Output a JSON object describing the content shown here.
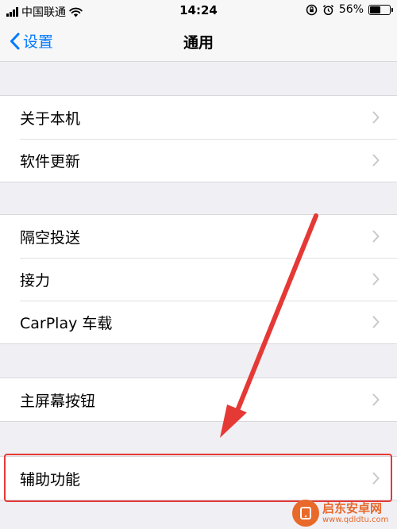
{
  "status_bar": {
    "carrier": "中国联通",
    "time": "14:24",
    "battery_percent": "56%",
    "battery_level": 0.56
  },
  "nav": {
    "back_label": "设置",
    "title": "通用"
  },
  "groups": [
    {
      "items": [
        {
          "label": "关于本机"
        },
        {
          "label": "软件更新"
        }
      ]
    },
    {
      "items": [
        {
          "label": "隔空投送"
        },
        {
          "label": "接力"
        },
        {
          "label": "CarPlay 车载"
        }
      ]
    },
    {
      "items": [
        {
          "label": "主屏幕按钮"
        }
      ]
    },
    {
      "items": [
        {
          "label": "辅助功能"
        }
      ]
    }
  ],
  "annotation": {
    "color": "#e53935"
  },
  "watermark": {
    "title": "启东安卓网",
    "url": "www.qdldtu.com"
  },
  "colors": {
    "accent": "#007aff",
    "background": "#efeff4"
  }
}
